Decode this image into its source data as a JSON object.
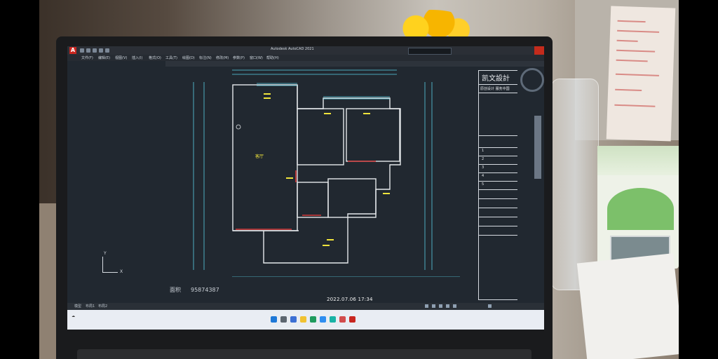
{
  "cad": {
    "window_title": "Autodesk AutoCAD 2021",
    "menu": [
      "文件(F)",
      "编辑(E)",
      "视图(V)",
      "插入(I)",
      "格式(O)",
      "工具(T)",
      "绘图(D)",
      "标注(N)",
      "修改(M)",
      "参数(P)",
      "窗口(W)",
      "帮助(H)"
    ],
    "axis_y": "Y",
    "axis_x": "X",
    "area_label": "面积",
    "area_value": "95874387",
    "room_label": "客厅",
    "title_block": {
      "company": "凯文設計",
      "subtitle": "原创设计 服务中国",
      "rows": [
        "1",
        "2",
        "3",
        "4",
        "5"
      ]
    },
    "status_left": [
      "模型",
      "布局1",
      "布局2"
    ]
  },
  "timestamp": "2022.07.06 17:34",
  "colors": {
    "cad_bg": "#212830",
    "lines": "#e6e9ec",
    "dim": "#5ad0e6",
    "wall_red": "#d43a3a",
    "text_yellow": "#f0e43c"
  }
}
